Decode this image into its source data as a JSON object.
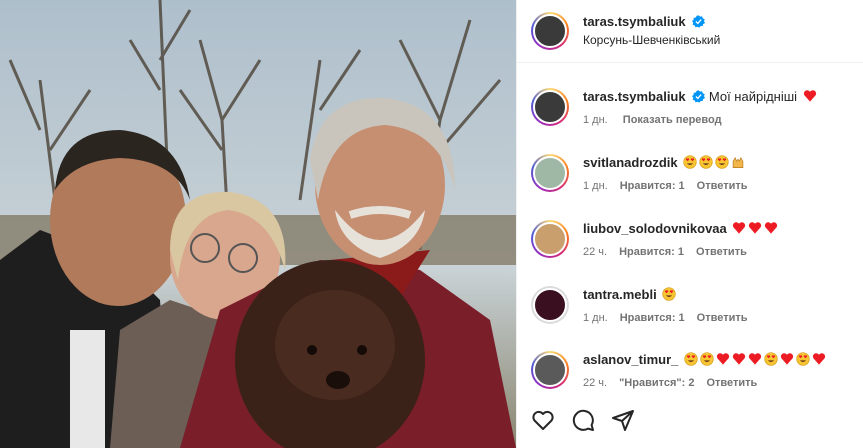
{
  "post": {
    "username": "taras.tsymbaliuk",
    "location": "Корсунь-Шевченківський",
    "caption_text": "Мої найрідніші",
    "caption_time": "1 дн.",
    "translate_label": "Показать перевод"
  },
  "comments": [
    {
      "user": "svitlanadrozdik",
      "emojis": [
        "heart-eyes",
        "heart-eyes",
        "heart-eyes",
        "raised-hands"
      ],
      "time": "1 дн.",
      "likes": "Нравится: 1",
      "reply": "Ответить"
    },
    {
      "user": "liubov_solodovnikovaa",
      "emojis": [
        "heart",
        "heart",
        "heart"
      ],
      "time": "22 ч.",
      "likes": "Нравится: 1",
      "reply": "Ответить"
    },
    {
      "user": "tantra.mebli",
      "emojis": [
        "heart-eyes"
      ],
      "time": "1 дн.",
      "likes": "Нравится: 1",
      "reply": "Ответить"
    },
    {
      "user": "aslanov_timur_",
      "emojis": [
        "heart-eyes",
        "heart-eyes",
        "heart",
        "heart",
        "heart",
        "heart-eyes",
        "heart",
        "heart-eyes",
        "heart"
      ],
      "time": "22 ч.",
      "likes": "\"Нравится\": 2",
      "reply": "Ответить"
    }
  ],
  "actions": [
    "like-icon",
    "comment-icon",
    "share-icon"
  ],
  "colors": {
    "verified": "#0095f6",
    "heart": "#ed1c24",
    "meta": "#737373"
  }
}
